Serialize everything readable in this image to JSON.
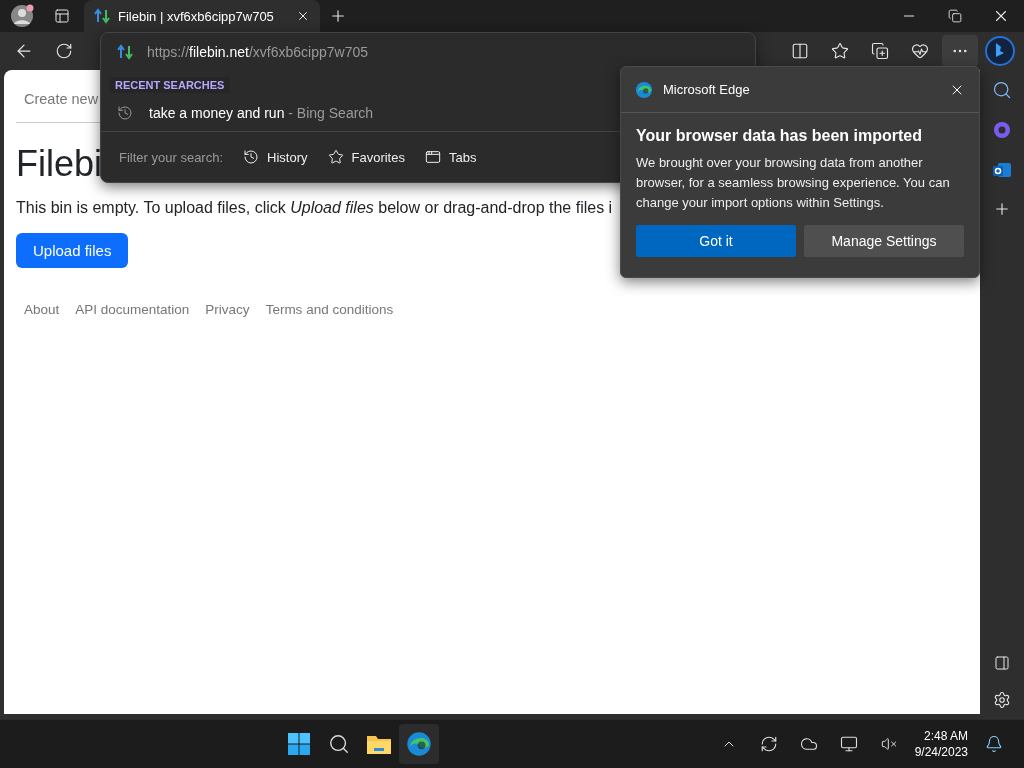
{
  "browser": {
    "tab": {
      "title": "Filebin | xvf6xb6cipp7w705"
    },
    "address_bar": {
      "scheme": "https://",
      "host": "filebin.net",
      "path": "/xvf6xb6cipp7w705"
    },
    "suggestions": {
      "heading": "RECENT SEARCHES",
      "items": [
        {
          "query": "take a money and run",
          "source": "- Bing Search"
        }
      ],
      "filter_label": "Filter your search:",
      "filters": [
        {
          "label": "History",
          "kind": "history"
        },
        {
          "label": "Favorites",
          "kind": "favorites"
        },
        {
          "label": "Tabs",
          "kind": "tabs"
        }
      ]
    }
  },
  "page": {
    "nav_link": "Create new",
    "heading": "Filebi",
    "message": "This bin is empty. To upload files, click *Upload files* below or drag-and-drop the files i",
    "upload_button": "Upload files",
    "footer_links": [
      "About",
      "API documentation",
      "Privacy",
      "Terms and conditions"
    ]
  },
  "notification": {
    "app": "Microsoft Edge",
    "title": "Your browser data has been imported",
    "body": "We brought over your browsing data from another browser, for a seamless browsing experience. You can change your import options within Settings.",
    "buttons": [
      {
        "label": "Got it",
        "primary": true
      },
      {
        "label": "Manage Settings",
        "primary": false
      }
    ]
  },
  "taskbar": {
    "time": "2:48 AM",
    "date": "9/24/2023"
  }
}
